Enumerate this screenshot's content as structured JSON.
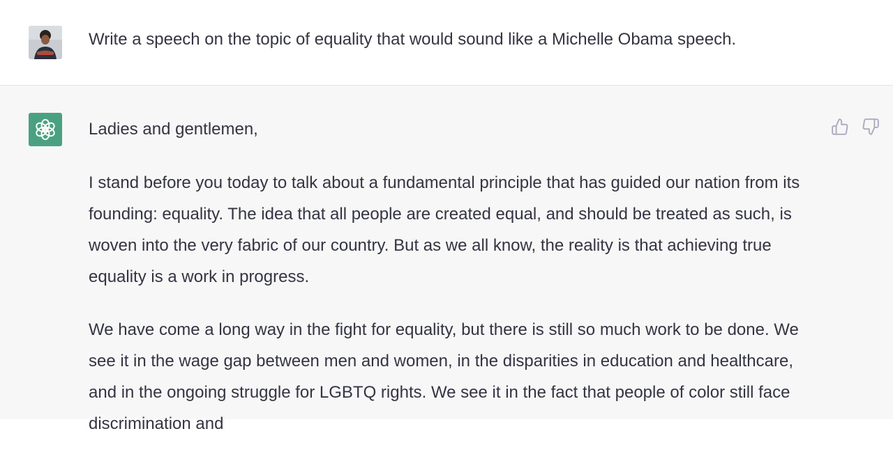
{
  "conversation": {
    "user_message": "Write a speech on the topic of equality that would sound like a Michelle Obama speech.",
    "assistant_paragraphs": [
      "Ladies and gentlemen,",
      "I stand before you today to talk about a fundamental principle that has guided our nation from its founding: equality. The idea that all people are created equal, and should be treated as such, is woven into the very fabric of our country. But as we all know, the reality is that achieving true equality is a work in progress.",
      "We have come a long way in the fight for equality, but there is still so much work to be done. We see it in the wage gap between men and women, in the disparities in education and healthcare, and in the ongoing struggle for LGBTQ rights. We see it in the fact that people of color still face discrimination and"
    ]
  },
  "icons": {
    "user_avatar": "user-avatar-photo",
    "assistant_avatar": "openai-logo-icon",
    "thumbs_up": "thumbs-up-icon",
    "thumbs_down": "thumbs-down-icon"
  },
  "colors": {
    "assistant_background": "#f7f7f8",
    "assistant_avatar_bg": "#4aa181",
    "text": "#343541",
    "feedback_icon": "#acacbe"
  }
}
